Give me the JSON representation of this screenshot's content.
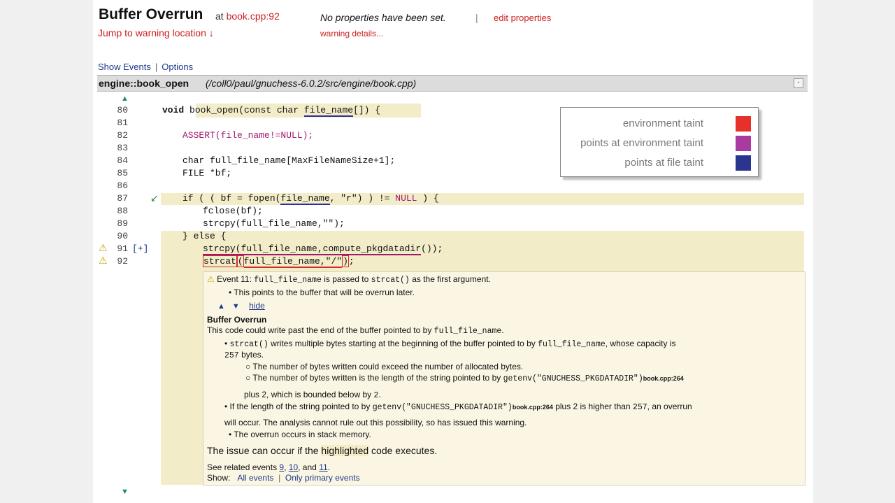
{
  "header": {
    "title": "Buffer Overrun",
    "at_label": "at",
    "location": "book.cpp:92",
    "jump_link": "Jump to warning location ↓",
    "properties_text": "No properties have been set.",
    "separator": "|",
    "edit_properties": "edit properties",
    "warning_details": "warning details..."
  },
  "toolbar": {
    "show_events": "Show Events",
    "sep": "|",
    "options": "Options"
  },
  "function_bar": {
    "name": "engine::book_open",
    "path": "(/coll0/paul/gnuchess-6.0.2/src/engine/book.cpp)",
    "minimize": "-"
  },
  "code": {
    "line_numbers": [
      "80",
      "81",
      "82",
      "83",
      "84",
      "85",
      "86",
      "87",
      "88",
      "89",
      "90",
      "91",
      "92"
    ],
    "l80_a": "void ",
    "l80_b": "book_open",
    "l80_c": "(const char ",
    "l80_d": "file_name",
    "l80_e": "[]) {",
    "l82": "ASSERT(file_name!=NULL);",
    "l84": "char full_file_name[MaxFileNameSize+1];",
    "l85": "FILE *bf;",
    "l87_a": "if ( ( bf = fopen(",
    "l87_b": "file_name",
    "l87_c": ", \"r\") ) != ",
    "l87_d": "NULL",
    "l87_e": " ) {",
    "l88": "fclose(bf);",
    "l89": "strcpy(full_file_name,\"\");",
    "l90": "} else {",
    "l91_a": "strcpy(full_file_name,",
    "l91_b": "compute_pkgdatadir",
    "l91_c": "());",
    "l92_a": "strcat",
    "l92_b": "(",
    "l92_c": "full_file_name,\"/\"",
    "l92_d": ")",
    "l92_e": ";",
    "expand": "[+]",
    "nav_arrow": "↙"
  },
  "legend": {
    "items": [
      {
        "label": "environment taint",
        "color": "#e8302a"
      },
      {
        "label": "points at environment taint",
        "color": "#a83aa0"
      },
      {
        "label": "points at file taint",
        "color": "#2b3590"
      }
    ]
  },
  "event": {
    "header_a": "Event 11:",
    "header_b": "full_file_name",
    "header_c": "is passed to",
    "header_d": "strcat()",
    "header_e": "as the first argument.",
    "bullet1": "This points to the buffer that will be overrun later.",
    "hide": "hide",
    "section_title": "Buffer Overrun",
    "desc_a": "This code could write past the end of the buffer pointed to by",
    "desc_b": "full_file_name",
    "desc_c": ".",
    "b1_a": "strcat()",
    "b1_b": "writes multiple bytes starting at the beginning of the buffer pointed to by",
    "b1_c": "full_file_name",
    "b1_d": ", whose capacity is",
    "b1_e": "257",
    "b1_f": "bytes.",
    "s1": "The number of bytes written could exceed the number of allocated bytes.",
    "s2_a": "The number of bytes written is the length of the string pointed to by",
    "s2_b": "getenv(\"GNUCHESS_PKGDATADIR\")",
    "s2_ref": "book.cpp:264",
    "s2_c": "plus 2, which is bounded below by",
    "s2_d": "2",
    "s2_e": ".",
    "b2_a": "If the length of the string pointed to by",
    "b2_b": "getenv(\"GNUCHESS_PKGDATADIR\")",
    "b2_ref": "book.cpp:264",
    "b2_c": "plus 2 is higher than",
    "b2_d": "257",
    "b2_e": ", an overrun",
    "b2_f": "will occur.  The analysis cannot rule out this possibility, so has issued this warning.",
    "b3": "The overrun occurs in stack memory.",
    "issue_a": "The issue can occur if the",
    "issue_b": "highlighted",
    "issue_c": "code executes.",
    "related_a": "See related events",
    "related_9": "9",
    "related_10": "10",
    "related_and": ", and",
    "related_11": "11",
    "show_label": "Show:",
    "all_events": "All events",
    "only_primary": "Only primary events"
  }
}
